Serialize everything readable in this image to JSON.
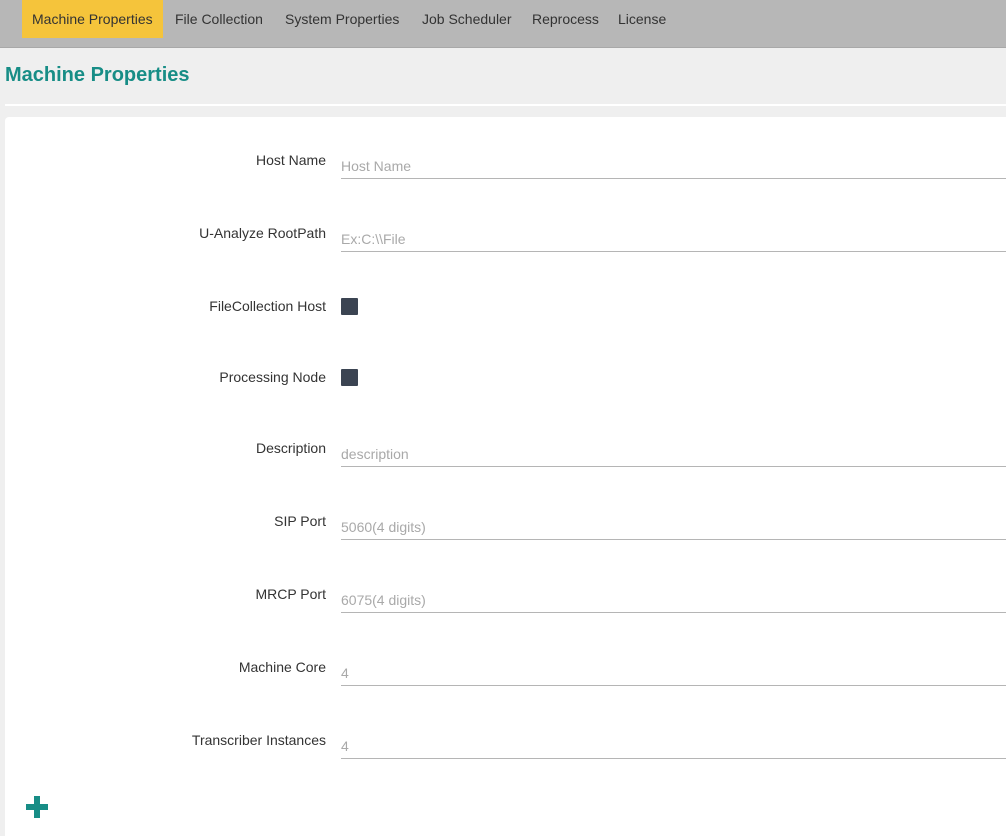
{
  "tabs": [
    {
      "label": "Machine Properties",
      "active": true
    },
    {
      "label": "File Collection",
      "active": false
    },
    {
      "label": "System Properties",
      "active": false
    },
    {
      "label": "Job Scheduler",
      "active": false
    },
    {
      "label": "Reprocess",
      "active": false
    },
    {
      "label": "License",
      "active": false
    }
  ],
  "page_title": "Machine Properties",
  "form": {
    "host_name": {
      "label": "Host Name",
      "value": "",
      "placeholder": "Host Name"
    },
    "root_path": {
      "label": "U-Analyze RootPath",
      "value": "",
      "placeholder": "Ex:C:\\\\File"
    },
    "filecollection_host": {
      "label": "FileCollection Host",
      "checked": false
    },
    "processing_node": {
      "label": "Processing Node",
      "checked": false
    },
    "description": {
      "label": "Description",
      "value": "",
      "placeholder": "description"
    },
    "sip_port": {
      "label": "SIP Port",
      "value": "",
      "placeholder": "5060(4 digits)"
    },
    "mrcp_port": {
      "label": "MRCP Port",
      "value": "",
      "placeholder": "6075(4 digits)"
    },
    "machine_core": {
      "label": "Machine Core",
      "value": "",
      "placeholder": "4"
    },
    "transcriber_instances": {
      "label": "Transcriber Instances",
      "value": "",
      "placeholder": "4"
    }
  },
  "colors": {
    "accent": "#178d86",
    "active_tab": "#f5c43b",
    "tabbar": "#b7b7b7",
    "checkbox": "#3b4452"
  },
  "icons": {
    "add": "plus-icon"
  }
}
